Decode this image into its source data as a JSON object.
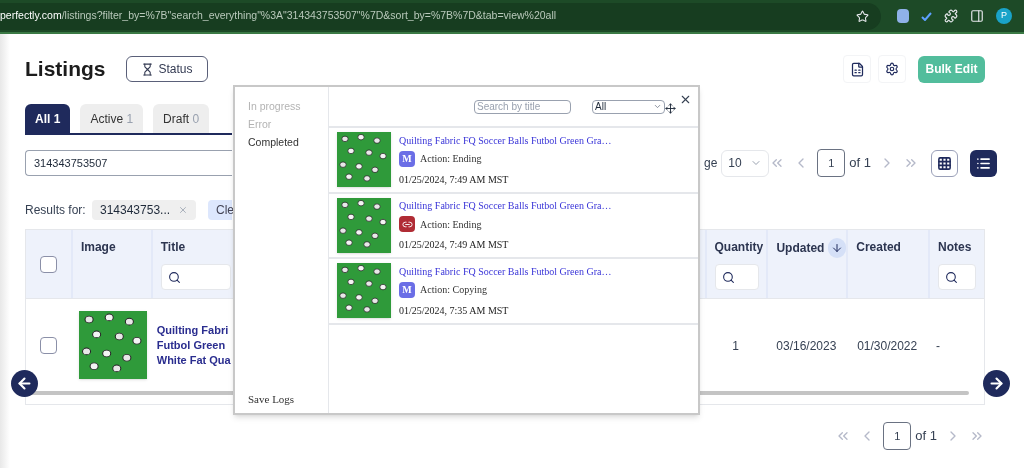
{
  "browser": {
    "url_domain": "perfectly.com",
    "url_path": "/listings?filter_by=%7B\"search_everything\"%3A\"314343753507\"%7D&sort_by=%7B%7D&tab=view%20all",
    "profile_initial": "P"
  },
  "page": {
    "title": "Listings",
    "status_button": "Status",
    "bulk_edit": "Bulk Edit"
  },
  "tabs": [
    {
      "label": "All",
      "count": "1",
      "selected": true
    },
    {
      "label": "Active",
      "count": "1",
      "selected": false
    },
    {
      "label": "Draft",
      "count": "0",
      "selected": false
    }
  ],
  "search": {
    "value": "314343753507"
  },
  "per_page": {
    "label": "ge",
    "value": "10"
  },
  "pagination_top": {
    "page": "1",
    "total": "of 1"
  },
  "view_toggle": [
    {
      "kind": "grid",
      "selected": false
    },
    {
      "kind": "list",
      "selected": true
    }
  ],
  "results": {
    "label": "Results for:",
    "chip": "314343753...",
    "clear": "Cle"
  },
  "table": {
    "select_all": {
      "checked": false
    },
    "columns": [
      {
        "label": "Image",
        "kind": "plain"
      },
      {
        "label": "Title",
        "kind": "search"
      },
      {
        "label": "Quantity",
        "kind": "search"
      },
      {
        "label": "Updated",
        "kind": "sorted"
      },
      {
        "label": "Created",
        "kind": "plain"
      },
      {
        "label": "Notes",
        "kind": "search"
      }
    ],
    "rows": [
      {
        "checked": false,
        "title_lines": [
          "Quilting Fabri",
          "Futbol Green",
          "White Fat Qua"
        ],
        "quantity": "1",
        "updated": "03/16/2023",
        "created": "01/30/2022",
        "notes": "-"
      }
    ]
  },
  "pagination_bottom": {
    "page": "1",
    "total": "of 1"
  },
  "log_popup": {
    "filters": [
      {
        "label": "In progress",
        "selected": false
      },
      {
        "label": "Error",
        "selected": false
      },
      {
        "label": "Completed",
        "selected": true
      }
    ],
    "save_logs": "Save Logs",
    "search_placeholder": "Search by title",
    "select_value": "All",
    "entries": [
      {
        "title": "Quilting Fabric FQ Soccer Balls Futbol Green Gra…",
        "badge": {
          "kind": "letter",
          "text": "M"
        },
        "action": "Action: Ending",
        "date": "01/25/2024, 7:49 AM MST"
      },
      {
        "title": "Quilting Fabric FQ Soccer Balls Futbol Green Gra…",
        "badge": {
          "kind": "chain"
        },
        "action": "Action: Ending",
        "date": "01/25/2024, 7:49 AM MST"
      },
      {
        "title": "Quilting Fabric FQ Soccer Balls Futbol Green Gra…",
        "badge": {
          "kind": "letter",
          "text": "M"
        },
        "action": "Action: Copying",
        "date": "01/25/2024, 7:35 AM MST"
      }
    ]
  }
}
